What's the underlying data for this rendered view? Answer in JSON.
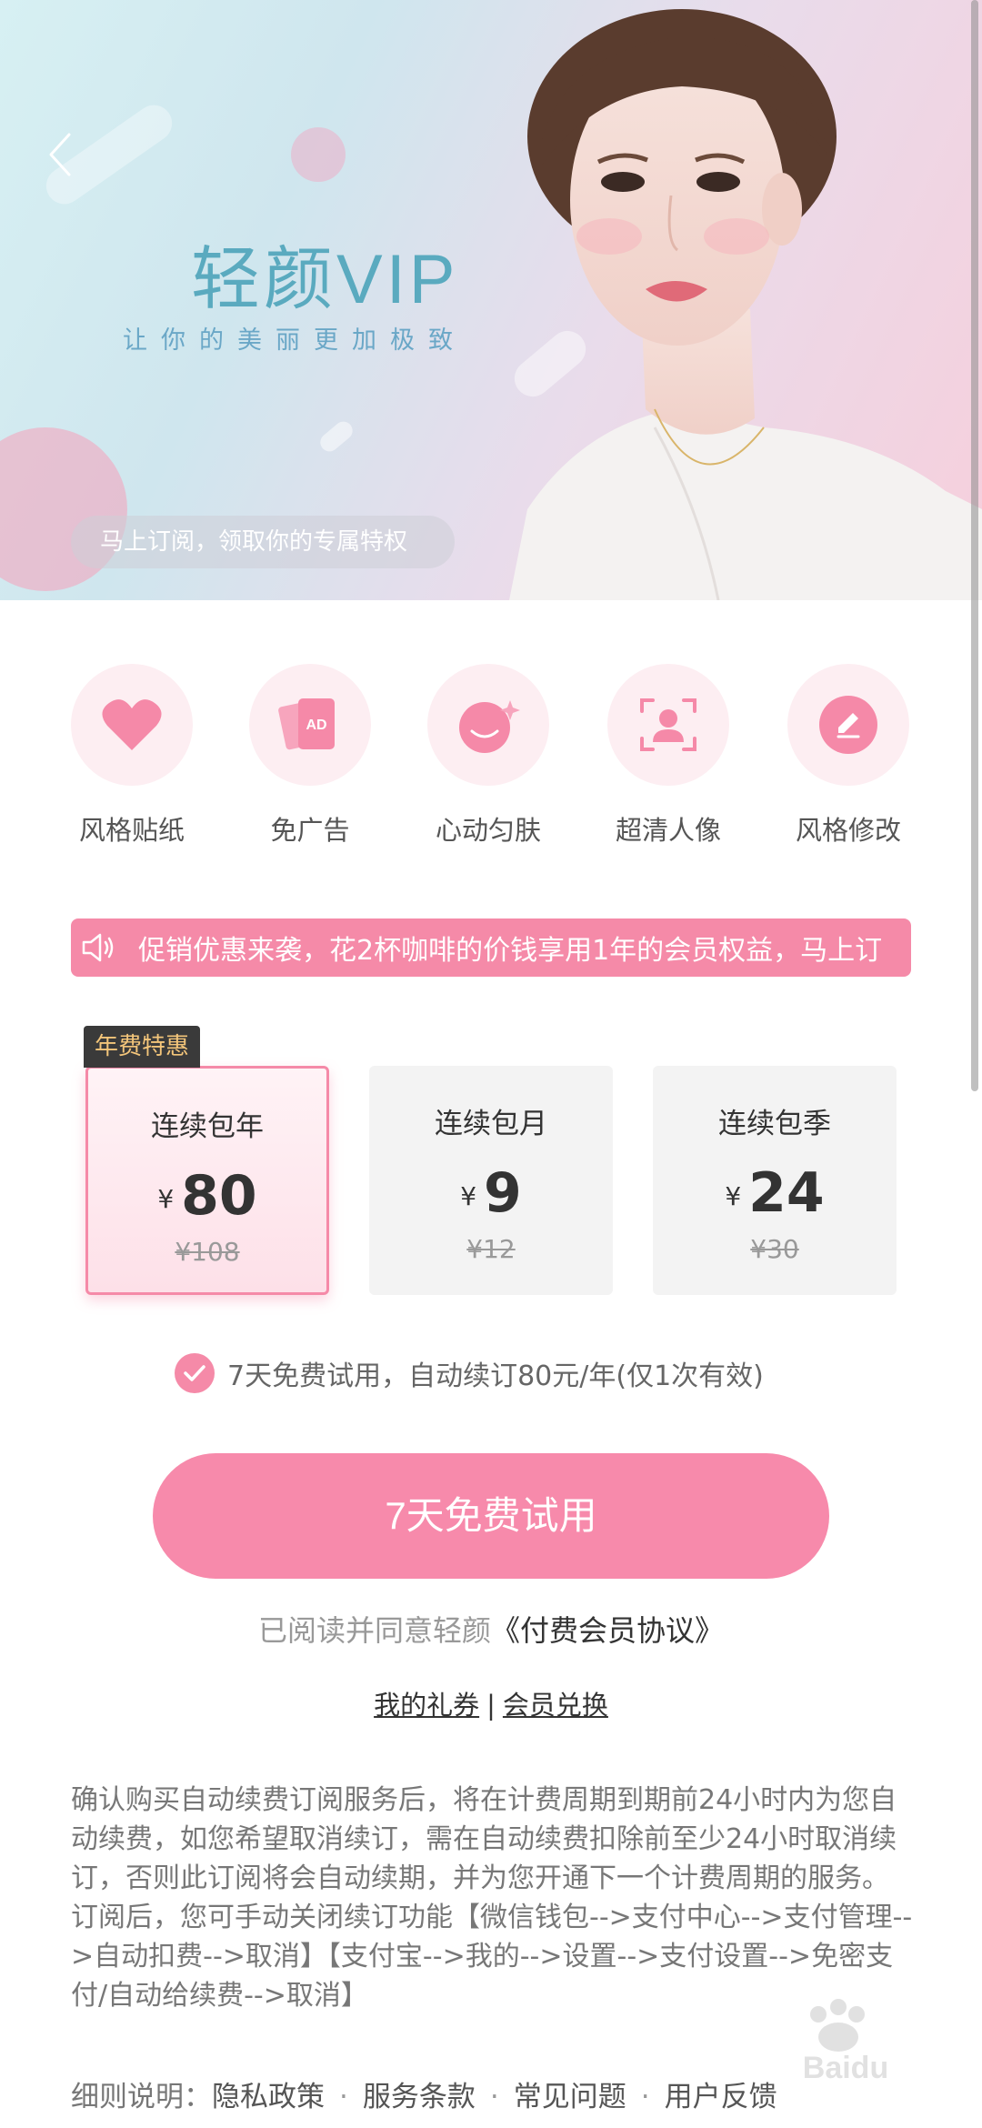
{
  "banner": {
    "title": "轻颜VIP",
    "subtitle": "让你的美丽更加极致",
    "pill_text": "马上订阅，领取你的专属特权"
  },
  "features": [
    {
      "label": "风格贴纸",
      "icon": "heart-icon"
    },
    {
      "label": "免广告",
      "icon": "ad-card-icon"
    },
    {
      "label": "心动匀肤",
      "icon": "face-sparkle-icon"
    },
    {
      "label": "超清人像",
      "icon": "portrait-scan-icon"
    },
    {
      "label": "风格修改",
      "icon": "edit-pencil-icon"
    }
  ],
  "marquee": {
    "text": "促销优惠来袭，花2杯咖啡的价钱享用1年的会员权益，马上订"
  },
  "plans": {
    "badge": "年费特惠",
    "items": [
      {
        "name": "连续包年",
        "currency": "¥",
        "price": "80",
        "original": "¥108",
        "selected": true
      },
      {
        "name": "连续包月",
        "currency": "¥",
        "price": "9",
        "original": "¥12",
        "selected": false
      },
      {
        "name": "连续包季",
        "currency": "¥",
        "price": "24",
        "original": "¥30",
        "selected": false
      }
    ]
  },
  "trial_note": "7天免费试用，自动续订80元/年(仅1次有效)",
  "cta_label": "7天免费试用",
  "agreement": {
    "prefix": "已阅读并同意轻颜",
    "link": "《付费会员协议》"
  },
  "links": {
    "coupons": "我的礼券",
    "separator": "|",
    "redeem": "会员兑换"
  },
  "terms": {
    "para1": "确认购买自动续费订阅服务后，将在计费周期到期前24小时内为您自动续费，如您希望取消续订，需在自动续费扣除前至少24小时取消续订，否则此订阅将会自动续期，并为您开通下一个计费周期的服务。",
    "para2": "订阅后，您可手动关闭续订功能【微信钱包-->支付中心-->支付管理-->自动扣费-->取消】【支付宝-->我的-->设置-->支付设置-->免密支付/自动给续费-->取消】"
  },
  "footer": {
    "label": "细则说明：",
    "items": [
      "隐私政策",
      "服务条款",
      "常见问题",
      "用户反馈"
    ]
  },
  "colors": {
    "accent_pink": "#f78aab",
    "badge_dark": "#3a3a3a",
    "badge_gold": "#f3c57a",
    "brand_teal": "#5aaabf"
  }
}
